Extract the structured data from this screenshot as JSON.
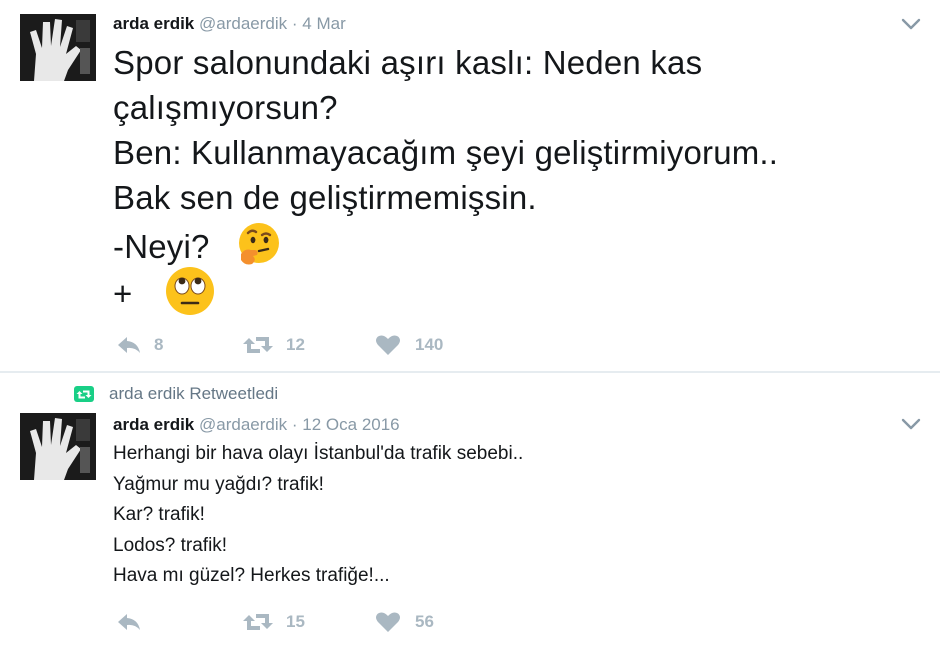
{
  "tweets": [
    {
      "author_name": "arda erdik",
      "handle": "@ardaerdik",
      "separator": "·",
      "time": "4 Mar",
      "lines": [
        "Spor salonundaki aşırı kaslı: Neden kas",
        "çalışmıyorsun?",
        "Ben: Kullanmayacağım şeyi geliştirmiyorum..",
        "Bak sen de geliştirmemişsin.",
        "-Neyi?",
        "+"
      ],
      "emojis": [
        "thinking-face-icon",
        "face-with-rolling-eyes-icon"
      ],
      "replies": "8",
      "retweets": "12",
      "likes": "140"
    },
    {
      "retweet_label": "arda erdik Retweetledi",
      "author_name": "arda erdik",
      "handle": "@ardaerdik",
      "separator": "·",
      "time": "12 Oca 2016",
      "lines": [
        "Herhangi bir hava olayı İstanbul'da trafik sebebi..",
        "Yağmur mu yağdı? trafik!",
        "Kar? trafik!",
        "Lodos? trafik!",
        "Hava mı güzel? Herkes trafiğe!..."
      ],
      "replies": "",
      "retweets": "15",
      "likes": "56"
    }
  ],
  "colors": {
    "text": "#14171a",
    "muted": "#8899a6",
    "action_icon": "#aab8c2",
    "retweet_green": "#19cf86",
    "divider": "#e6ecf0"
  }
}
